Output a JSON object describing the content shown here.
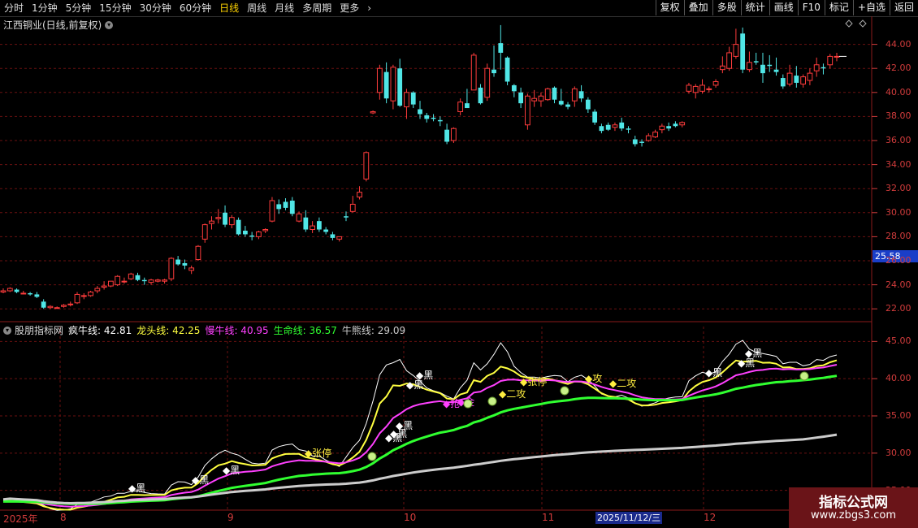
{
  "toolbar": {
    "periods": [
      "分时",
      "1分钟",
      "5分钟",
      "15分钟",
      "30分钟",
      "60分钟",
      "日线",
      "周线",
      "月线",
      "多周期",
      "更多"
    ],
    "active_period": "日线",
    "right_buttons": [
      "复权",
      "叠加",
      "多股",
      "统计",
      "画线",
      "F10",
      "标记",
      "+自选",
      "返回"
    ]
  },
  "chart": {
    "title": "江西铜业(日线,前复权)",
    "price_tag": "25.58",
    "axis_labels": [
      "44.00",
      "42.00",
      "40.00",
      "38.00",
      "36.00",
      "34.00",
      "32.00",
      "30.00",
      "28.00",
      "26.00",
      "24.00",
      "22.00"
    ]
  },
  "indicator": {
    "name": "股朋指标网",
    "lines": [
      {
        "label": "疯牛线:",
        "value": "42.81",
        "color": "#ffffff"
      },
      {
        "label": "龙头线:",
        "value": "42.25",
        "color": "#ffff40"
      },
      {
        "label": "慢牛线:",
        "value": "40.95",
        "color": "#ff40ff"
      },
      {
        "label": "生命线:",
        "value": "36.57",
        "color": "#30ff30"
      },
      {
        "label": "牛熊线:",
        "value": "29.09",
        "color": "#cccccc"
      }
    ],
    "axis_labels": [
      "45.00",
      "40.00",
      "35.00",
      "30.00",
      "25.00"
    ],
    "signals": [
      "黑",
      "黑",
      "黑",
      "张停",
      "黑",
      "黑",
      "黑",
      "黑",
      "黑",
      "抢",
      "金",
      "二攻",
      "张停",
      "攻",
      "二攻",
      "黑",
      "黑",
      "黑"
    ]
  },
  "dates": {
    "labels": [
      "2025年",
      "8",
      "9",
      "10",
      "11",
      "12"
    ],
    "cursor": "2025/11/12/三"
  },
  "watermark": {
    "line1": "指标公式网",
    "line2": "www.zbgs3.com"
  },
  "colors": {
    "up": "#ff3c3c",
    "down": "#50e6e6",
    "grid": "#6a1010"
  },
  "chart_data": {
    "type": "candlestick",
    "candles": [
      [
        23.4,
        23.7,
        23.3,
        23.5
      ],
      [
        23.5,
        23.8,
        23.4,
        23.7
      ],
      [
        23.6,
        23.7,
        23.3,
        23.4
      ],
      [
        23.3,
        23.5,
        23.2,
        23.3
      ],
      [
        23.3,
        23.4,
        23.1,
        23.2
      ],
      [
        23.2,
        23.4,
        22.9,
        23.0
      ],
      [
        22.6,
        22.8,
        22.0,
        22.1
      ],
      [
        22.1,
        22.3,
        22.0,
        22.2
      ],
      [
        22.1,
        22.2,
        22.0,
        22.1
      ],
      [
        22.2,
        22.4,
        22.1,
        22.3
      ],
      [
        22.4,
        22.6,
        22.2,
        22.4
      ],
      [
        22.5,
        23.4,
        22.4,
        23.2
      ],
      [
        23.1,
        23.3,
        22.8,
        23.1
      ],
      [
        23.1,
        23.5,
        23.0,
        23.4
      ],
      [
        23.5,
        23.9,
        23.3,
        23.7
      ],
      [
        23.8,
        24.3,
        23.6,
        23.9
      ],
      [
        23.9,
        24.3,
        23.8,
        24.3
      ],
      [
        24.0,
        24.8,
        23.9,
        24.7
      ],
      [
        24.3,
        24.6,
        24.1,
        24.3
      ],
      [
        24.5,
        25.0,
        24.4,
        24.9
      ],
      [
        24.8,
        25.0,
        24.3,
        24.4
      ],
      [
        24.4,
        24.6,
        24.0,
        24.3
      ],
      [
        24.2,
        24.5,
        24.0,
        24.4
      ],
      [
        24.3,
        24.5,
        24.2,
        24.4
      ],
      [
        24.3,
        24.5,
        24.1,
        24.4
      ],
      [
        24.5,
        26.3,
        24.3,
        26.2
      ],
      [
        26.1,
        26.4,
        25.6,
        25.7
      ],
      [
        25.8,
        26.1,
        25.3,
        25.6
      ],
      [
        25.2,
        25.6,
        24.9,
        25.4
      ],
      [
        26.1,
        27.3,
        26.0,
        27.2
      ],
      [
        27.8,
        29.1,
        27.5,
        29.0
      ],
      [
        29.1,
        29.7,
        28.6,
        29.3
      ],
      [
        29.5,
        30.3,
        29.1,
        29.6
      ],
      [
        30.0,
        30.6,
        28.8,
        29.0
      ],
      [
        29.0,
        29.8,
        28.7,
        29.6
      ],
      [
        29.4,
        29.6,
        28.1,
        28.2
      ],
      [
        28.5,
        28.9,
        28.0,
        28.2
      ],
      [
        28.1,
        28.4,
        27.7,
        28.0
      ],
      [
        28.0,
        28.5,
        27.8,
        28.4
      ],
      [
        28.5,
        28.7,
        28.3,
        28.6
      ],
      [
        29.3,
        31.3,
        29.2,
        31.0
      ],
      [
        30.7,
        31.1,
        29.9,
        30.3
      ],
      [
        30.9,
        31.2,
        30.2,
        30.4
      ],
      [
        31.0,
        31.3,
        29.7,
        29.9
      ],
      [
        29.3,
        30.1,
        29.2,
        29.9
      ],
      [
        29.6,
        30.2,
        28.4,
        28.6
      ],
      [
        28.6,
        29.3,
        28.3,
        28.9
      ],
      [
        29.3,
        29.6,
        28.4,
        28.6
      ],
      [
        28.6,
        28.8,
        28.2,
        28.4
      ],
      [
        28.2,
        28.4,
        27.7,
        27.9
      ],
      [
        27.8,
        28.0,
        27.6,
        28.0
      ],
      [
        29.7,
        30.1,
        29.3,
        29.6
      ],
      [
        30.1,
        31.4,
        30.0,
        30.7
      ],
      [
        31.3,
        32.2,
        31.1,
        31.7
      ],
      [
        32.8,
        35.1,
        32.6,
        35.0
      ],
      [
        38.3,
        38.5,
        38.2,
        38.4
      ],
      [
        40.0,
        42.3,
        39.4,
        42.0
      ],
      [
        41.7,
        42.5,
        39.1,
        39.5
      ],
      [
        39.3,
        42.3,
        38.6,
        42.1
      ],
      [
        42.0,
        42.8,
        38.8,
        38.9
      ],
      [
        38.8,
        40.3,
        37.8,
        40.0
      ],
      [
        40.0,
        40.1,
        38.7,
        39.0
      ],
      [
        38.6,
        39.3,
        37.8,
        38.2
      ],
      [
        38.1,
        38.3,
        37.5,
        37.8
      ],
      [
        37.9,
        38.2,
        37.6,
        37.8
      ],
      [
        37.7,
        38.0,
        37.2,
        37.6
      ],
      [
        36.9,
        37.4,
        35.7,
        35.9
      ],
      [
        36.0,
        37.1,
        35.8,
        37.0
      ],
      [
        38.4,
        39.5,
        38.1,
        39.2
      ],
      [
        39.1,
        40.3,
        38.7,
        38.7
      ],
      [
        40.2,
        43.3,
        40.2,
        43.1
      ],
      [
        40.4,
        40.7,
        39.0,
        39.1
      ],
      [
        39.6,
        42.4,
        39.3,
        42.0
      ],
      [
        41.9,
        43.9,
        41.3,
        41.6
      ],
      [
        44.1,
        45.6,
        41.9,
        43.3
      ],
      [
        42.9,
        43.0,
        40.6,
        40.9
      ],
      [
        40.6,
        40.7,
        39.6,
        40.1
      ],
      [
        40.0,
        40.4,
        38.7,
        39.1
      ],
      [
        37.3,
        39.9,
        36.9,
        39.7
      ],
      [
        39.3,
        40.2,
        38.8,
        39.5
      ],
      [
        39.3,
        40.0,
        38.8,
        39.7
      ],
      [
        39.4,
        40.4,
        39.3,
        40.3
      ],
      [
        40.4,
        40.5,
        39.1,
        39.4
      ],
      [
        39.3,
        40.3,
        38.9,
        39.0
      ],
      [
        39.0,
        39.2,
        38.6,
        38.8
      ],
      [
        39.3,
        40.5,
        38.8,
        40.3
      ],
      [
        40.1,
        40.6,
        39.2,
        39.5
      ],
      [
        39.4,
        39.6,
        38.3,
        38.6
      ],
      [
        38.4,
        38.6,
        37.3,
        37.5
      ],
      [
        37.2,
        37.4,
        36.6,
        36.8
      ],
      [
        37.3,
        37.5,
        36.8,
        36.9
      ],
      [
        37.1,
        37.5,
        36.8,
        37.3
      ],
      [
        37.5,
        37.9,
        36.8,
        37.0
      ],
      [
        37.0,
        37.2,
        36.6,
        36.9
      ],
      [
        36.1,
        36.4,
        35.5,
        35.7
      ],
      [
        35.9,
        36.1,
        35.5,
        35.8
      ],
      [
        36.0,
        36.6,
        35.9,
        36.4
      ],
      [
        36.3,
        36.9,
        36.2,
        36.7
      ],
      [
        36.9,
        37.4,
        36.6,
        37.2
      ],
      [
        37.2,
        37.5,
        36.8,
        37.0
      ],
      [
        37.4,
        37.6,
        37.1,
        37.2
      ],
      [
        37.3,
        37.6,
        37.1,
        37.5
      ],
      [
        40.1,
        40.8,
        39.9,
        40.6
      ],
      [
        40.0,
        40.7,
        39.5,
        40.5
      ],
      [
        40.1,
        41.1,
        39.9,
        40.6
      ],
      [
        40.3,
        40.5,
        40.0,
        40.3
      ],
      [
        40.6,
        41.1,
        40.4,
        40.9
      ],
      [
        41.9,
        43.0,
        41.6,
        42.2
      ],
      [
        42.0,
        43.8,
        41.8,
        43.3
      ],
      [
        43.0,
        45.3,
        42.8,
        44.0
      ],
      [
        44.9,
        45.4,
        41.6,
        41.9
      ],
      [
        41.9,
        43.4,
        41.7,
        42.5
      ],
      [
        42.6,
        43.3,
        42.3,
        42.5
      ],
      [
        42.3,
        43.3,
        40.8,
        41.6
      ],
      [
        42.3,
        43.1,
        41.7,
        42.2
      ],
      [
        41.9,
        42.9,
        41.4,
        41.7
      ],
      [
        41.2,
        41.5,
        40.3,
        40.5
      ],
      [
        40.7,
        42.3,
        40.5,
        41.6
      ],
      [
        41.4,
        42.2,
        40.4,
        40.8
      ],
      [
        40.7,
        41.5,
        40.4,
        41.3
      ],
      [
        41.0,
        42.0,
        40.6,
        41.6
      ],
      [
        41.8,
        42.9,
        41.3,
        42.3
      ],
      [
        42.1,
        42.4,
        41.5,
        42.0
      ],
      [
        42.3,
        43.2,
        42.0,
        43.0
      ],
      [
        43.0,
        43.3,
        42.6,
        43.0
      ]
    ],
    "ylim": [
      21.0,
      46.0
    ],
    "indicator_ylim": [
      23.0,
      47.0
    ]
  }
}
